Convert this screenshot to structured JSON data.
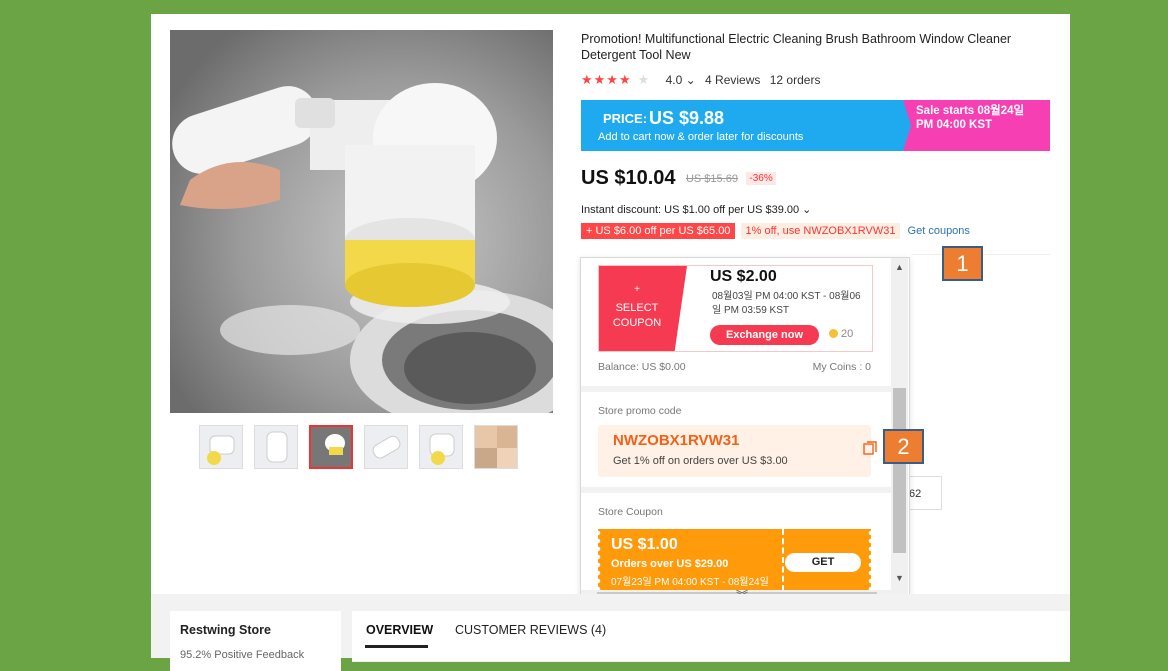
{
  "product": {
    "title": "Promotion! Multifunctional Electric Cleaning Brush Bathroom Window Cleaner Detergent Tool New",
    "stars": "★★★★",
    "star_empty": "★",
    "rating": "4.0 ⌄",
    "reviews": "4 Reviews",
    "orders": "12 orders"
  },
  "banner": {
    "price_label": "PRICE:",
    "price": "US $9.88",
    "subtitle": "Add to cart now & order later for discounts",
    "sale_text": "Sale starts 08월24일 PM 04:00 KST",
    "left_color": "#1faaf0",
    "right_color": "#f53fb2"
  },
  "pricing": {
    "price": "US $10.04",
    "original": "US $15.69",
    "discount": "-36%",
    "instant": "Instant discount: US $1.00 off per US $39.00 ⌄"
  },
  "tags": {
    "red": "+ US $6.00 off per US $65.00",
    "code": "1% off, use NWZOBX1RVW31",
    "get_coupons": "Get coupons"
  },
  "callouts": {
    "one": "1",
    "two": "2"
  },
  "share": {
    "count": "62"
  },
  "popup": {
    "coin_plus": "+",
    "select_coupon_line1": "SELECT",
    "select_coupon_line2": "COUPON",
    "coin_amount": "US $2.00",
    "coin_dates": "08월03일 PM 04:00 KST - 08월06일 PM 03:59 KST",
    "exchange_label": "Exchange now",
    "coin_cost": "20",
    "balance": "Balance: US $0.00",
    "my_coins": "My Coins : 0",
    "promo_label": "Store promo code",
    "promo_code": "NWZOBX1RVW31",
    "promo_desc": "Get 1% off on orders over US $3.00",
    "store_coupon_label": "Store Coupon",
    "sc_amount": "US $1.00",
    "sc_condition": "Orders over US $29.00",
    "sc_dates": "07월23일 PM 04:00 KST - 08월24일",
    "get_label": "GET",
    "scroll_up": "▲",
    "scroll_down": "▼",
    "scroll_left": "◀",
    "scroll_right": "▶",
    "chevron": "︾"
  },
  "bottom": {
    "store_name": "Restwing Store",
    "feedback": "95.2% Positive Feedback",
    "tab_overview": "OVERVIEW",
    "tab_reviews": "CUSTOMER REVIEWS (4)"
  }
}
